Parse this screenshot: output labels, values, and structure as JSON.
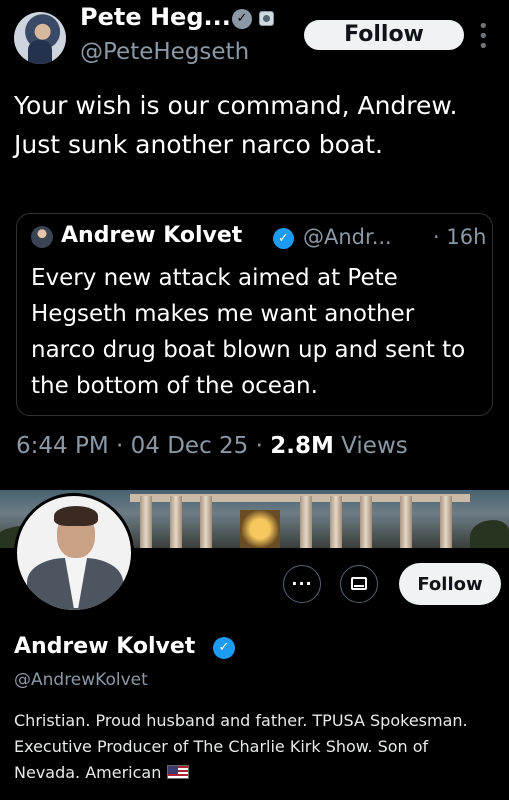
{
  "tweet": {
    "author_name": "Pete Heg...",
    "author_handle": "@PeteHegseth",
    "follow_label": "Follow",
    "more_label": "⋮",
    "text": "Your wish is our command, Andrew. Just sunk another narco boat.",
    "quote": {
      "author_name": "Andrew Kolvet",
      "author_handle": "@Andr...",
      "time": "· 16h",
      "text": "Every new attack aimed at Pete Hegseth makes me want another narco drug boat blown up and sent to the bottom of the ocean."
    },
    "meta": {
      "time": "6:44 PM",
      "sep1": " · ",
      "date": "04 Dec 25",
      "sep2": " · ",
      "views_count": "2.8M",
      "views_label": " Views"
    }
  },
  "profile": {
    "name": "Andrew Kolvet",
    "handle": "@AndrewKolvet",
    "more_label": "···",
    "follow_label": "Follow",
    "bio": "Christian. Proud husband and father. TPUSA Spokesman. Executive Producer of The Charlie Kirk Show. Son of Nevada. American"
  },
  "icons": {
    "verified_gray": "verified-gray-badge-icon",
    "government_badge": "government-badge-icon",
    "verified_blue": "verified-blue-badge-icon",
    "message": "envelope-icon",
    "flag": "us-flag-emoji"
  },
  "colors": {
    "background": "#000000",
    "primary_text": "#e7e9ea",
    "secondary_text": "#8b98a5",
    "verified_blue": "#1d9bf0",
    "follow_button_bg": "#eff3f4",
    "border": "#2f3336"
  }
}
